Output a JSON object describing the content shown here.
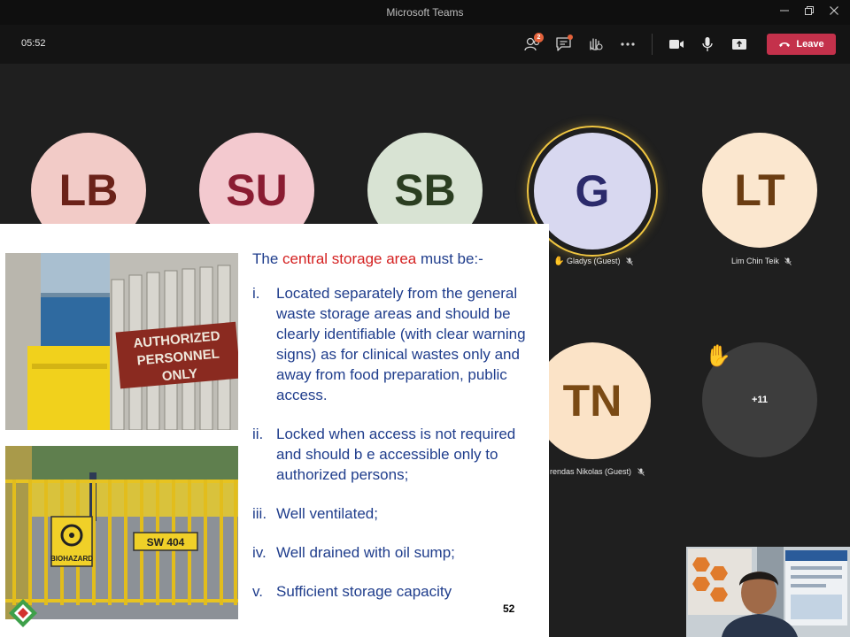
{
  "window": {
    "title": "Microsoft Teams",
    "minimize_icon": "minimize-icon",
    "restore_icon": "restore-icon",
    "close_icon": "close-icon"
  },
  "toolbar": {
    "timer": "05:52",
    "participants_badge": "2",
    "leave_label": "Leave",
    "colors": {
      "leave": "#c4314b",
      "badge": "#e4623b"
    }
  },
  "participants": [
    {
      "initials": "LB",
      "name": "",
      "bg": "#f2cbc7",
      "fg": "#6b2219"
    },
    {
      "initials": "SU",
      "name": "",
      "bg": "#f3c9cf",
      "fg": "#8a1c32"
    },
    {
      "initials": "SB",
      "name": "",
      "bg": "#d8e3d3",
      "fg": "#2b3e21"
    },
    {
      "initials": "G",
      "name": "Gladys (Guest)",
      "bg": "#d8d8f0",
      "fg": "#2b2a6b",
      "speaking": true,
      "hand_raised": true
    },
    {
      "initials": "LT",
      "name": "Lim Chin Teik",
      "bg": "#fbe7cf",
      "fg": "#6b3d12"
    },
    {
      "initials": "TN",
      "name": "rendas Nikolas (Guest)",
      "bg": "#fbe3c7",
      "fg": "#7a4a14"
    },
    {
      "initials": "+11",
      "name": "",
      "bg": "#3d3d3d",
      "fg": "#ffffff",
      "hand_raised": true
    }
  ],
  "slide": {
    "heading_prefix": "The ",
    "heading_highlight": "central storage area",
    "heading_suffix": " must be:-",
    "items": [
      {
        "num": "i.",
        "text": "Located separately from the general waste storage areas and should be clearly identifiable (with clear warning signs) as for clinical wastes only and away from food preparation, public access."
      },
      {
        "num": "ii.",
        "text": "Locked when access is not required and should b e accessible only to authorized persons;"
      },
      {
        "num": "iii.",
        "text": "Well ventilated;"
      },
      {
        "num": "iv.",
        "text": "Well drained with oil sump;"
      },
      {
        "num": "v.",
        "text": "Sufficient storage capacity"
      }
    ],
    "page_number": "52",
    "photo1_sign": [
      "AUTHORIZED",
      "PERSONNEL",
      "ONLY"
    ],
    "photo2_sign": "SW 404",
    "photo2_biohazard": "BIOHAZARD",
    "colors": {
      "text": "#1f3d8c",
      "highlight": "#d42020"
    }
  }
}
